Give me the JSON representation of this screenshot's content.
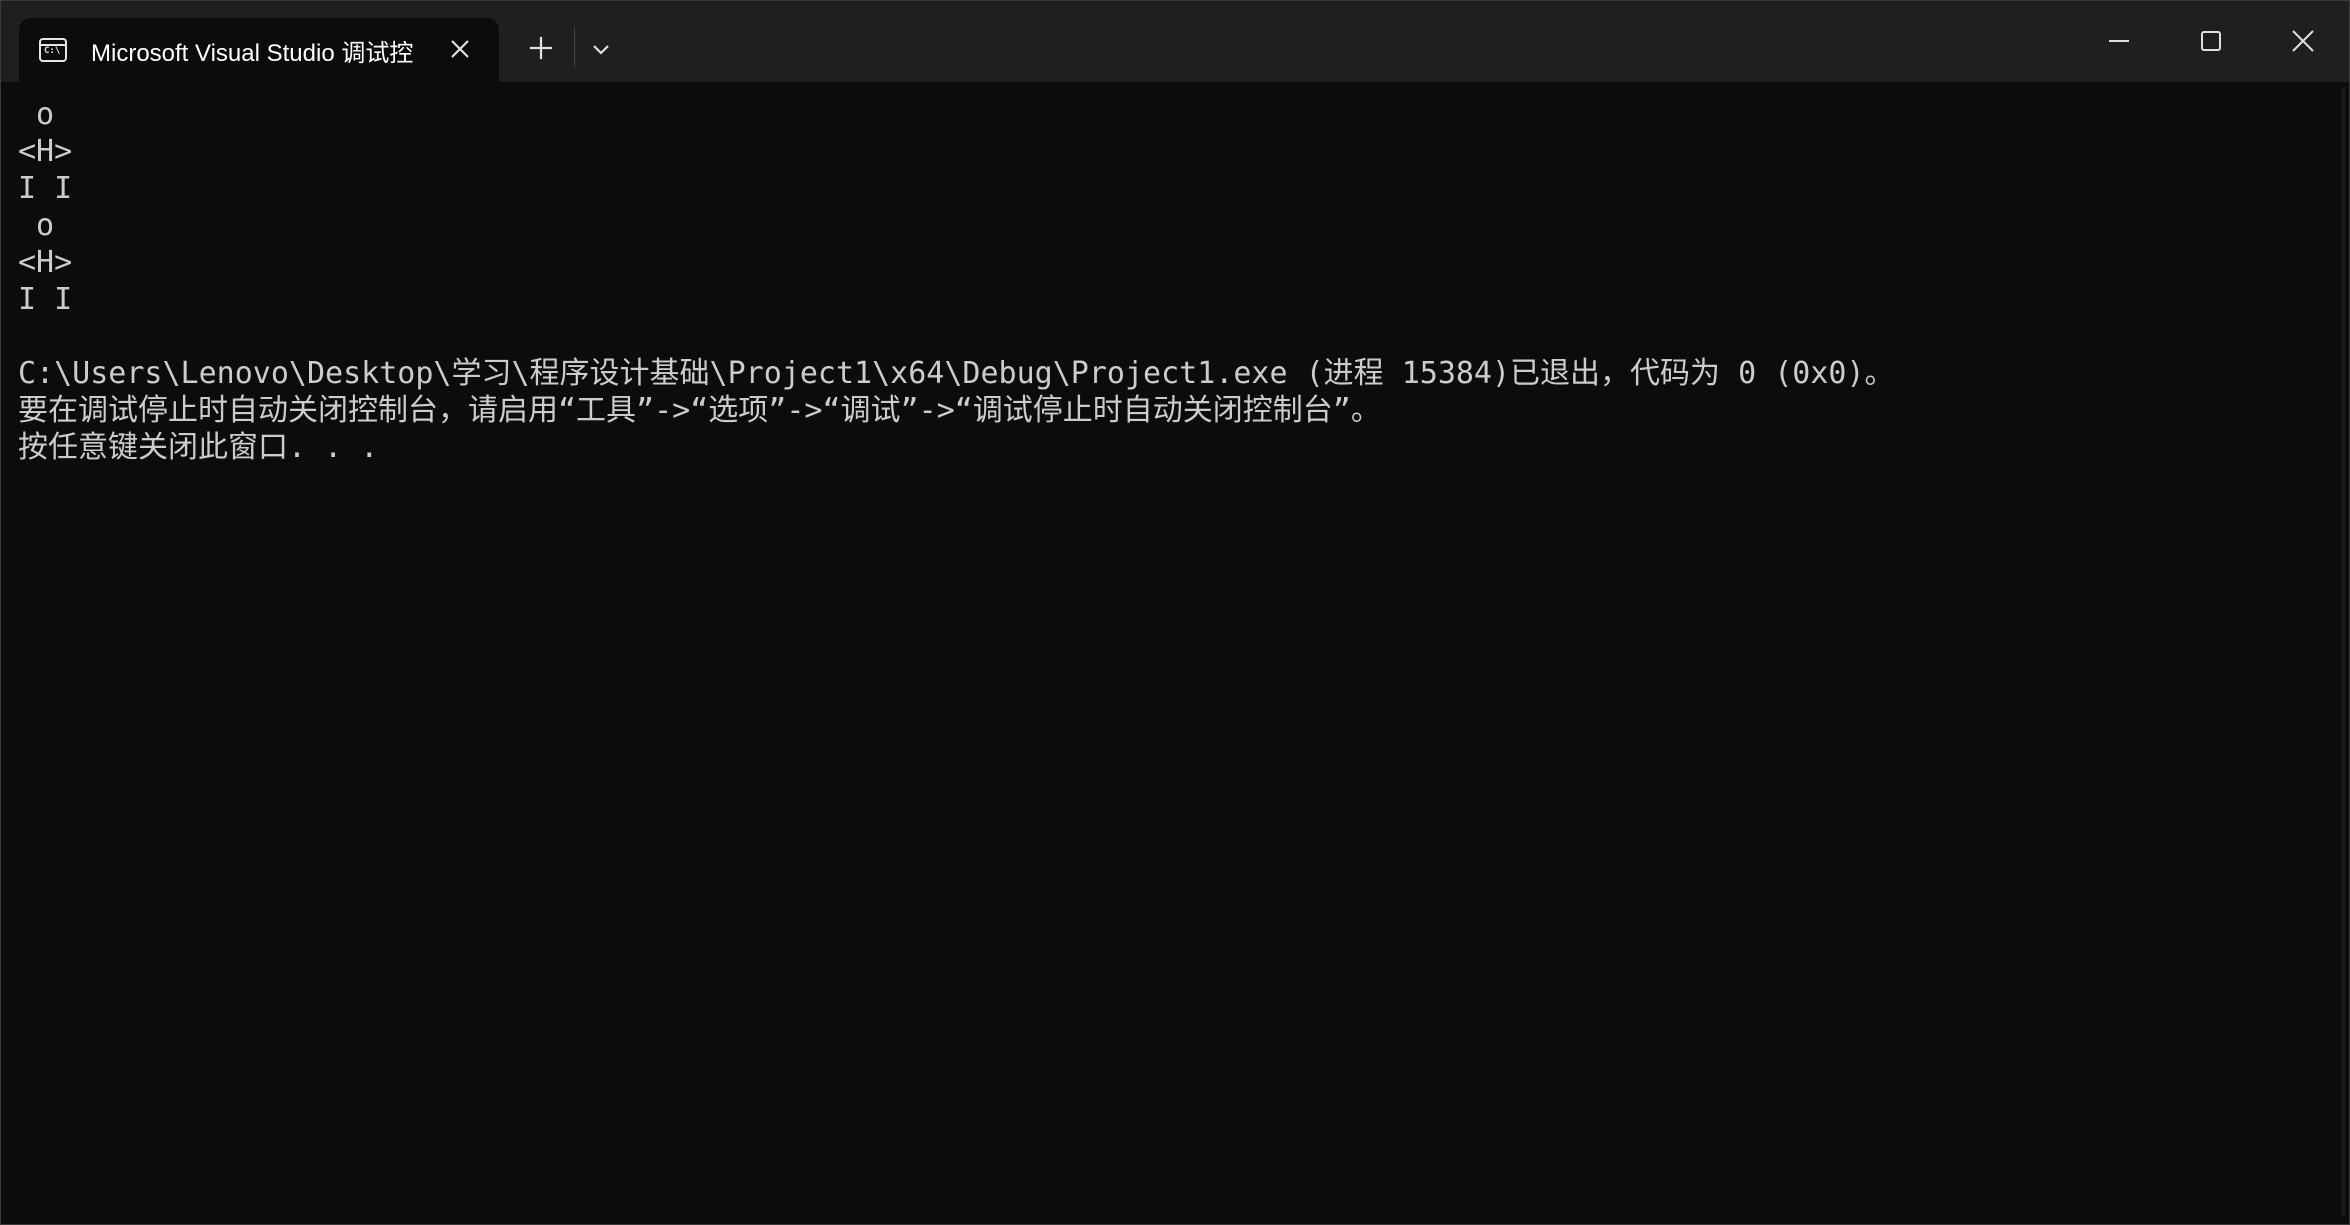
{
  "window": {
    "tab_title": "Microsoft Visual Studio 调试控",
    "tab_icon_text": "C:\\"
  },
  "console": {
    "lines": [
      " o",
      "<H>",
      "I I",
      " o",
      "<H>",
      "I I",
      "",
      "C:\\Users\\Lenovo\\Desktop\\学习\\程序设计基础\\Project1\\x64\\Debug\\Project1.exe (进程 15384)已退出，代码为 0 (0x0)。",
      "要在调试停止时自动关闭控制台，请启用“工具”->“选项”->“调试”->“调试停止时自动关闭控制台”。",
      "按任意键关闭此窗口. . ."
    ]
  },
  "colors": {
    "background": "#0c0c0c",
    "titlebar": "#1f1f1f",
    "text": "#cccccc"
  }
}
